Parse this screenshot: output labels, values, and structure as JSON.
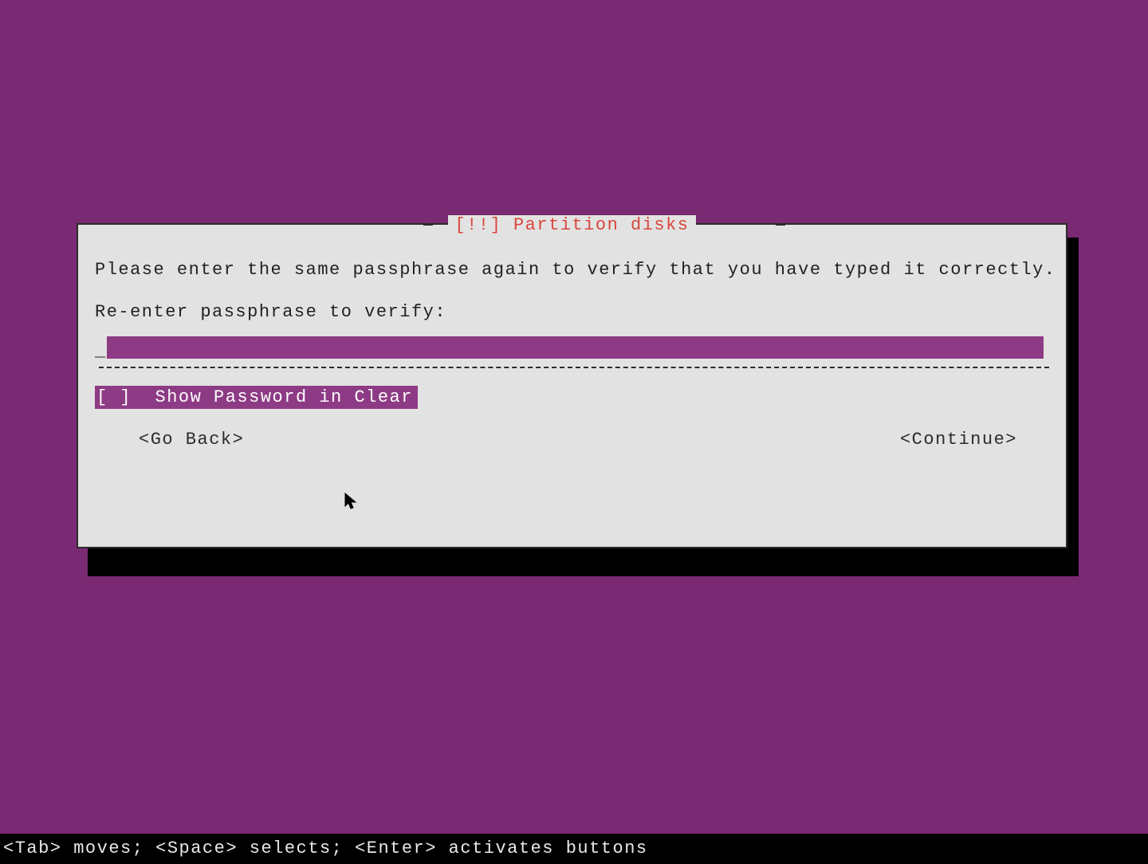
{
  "dialog": {
    "title": "[!!] Partition disks",
    "instruction": "Please enter the same passphrase again to verify that you have typed it correctly.",
    "prompt": "Re-enter passphrase to verify:",
    "input_value": "",
    "checkbox": {
      "checked": false,
      "label": "Show Password in Clear"
    },
    "go_back_label": "<Go Back>",
    "continue_label": "<Continue>"
  },
  "footer_hint": "<Tab> moves; <Space> selects; <Enter> activates buttons",
  "colors": {
    "background": "#7a2a72",
    "dialog_bg": "#e3e2e2",
    "accent": "#8e3b85",
    "title_color": "#d8473e"
  }
}
